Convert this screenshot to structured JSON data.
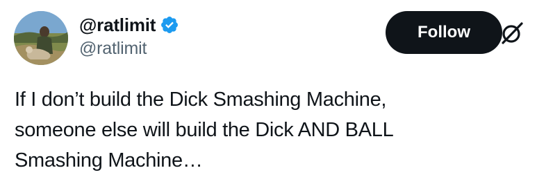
{
  "author": {
    "display_name": "@ratlimit",
    "handle": "@ratlimit",
    "verified": true,
    "avatar_icon": "profile-photo"
  },
  "actions": {
    "follow_label": "Follow"
  },
  "brand": {
    "logo_icon": "grok-logo-icon"
  },
  "tweet": {
    "lines": [
      "If I don’t build the Dick Smashing Machine,",
      "someone else will build the Dick AND BALL",
      "Smashing Machine…"
    ]
  },
  "colors": {
    "text_primary": "#0f1419",
    "text_secondary": "#536471",
    "verified_blue": "#1d9bf0",
    "button_bg": "#0f1419",
    "button_text": "#ffffff"
  }
}
